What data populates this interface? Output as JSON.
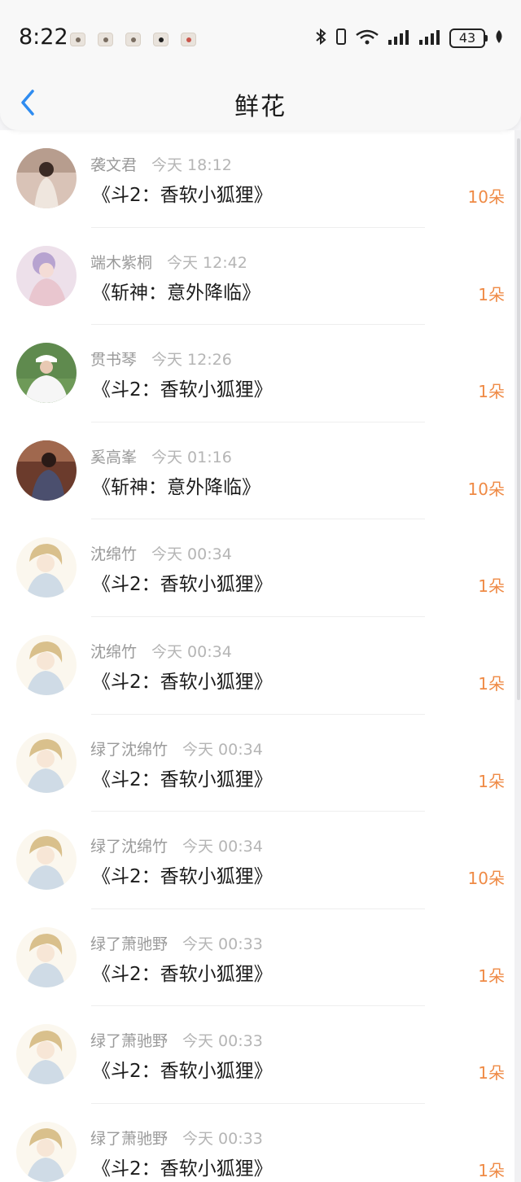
{
  "status_bar": {
    "time": "8:22",
    "battery": "43"
  },
  "header": {
    "title": "鲜花"
  },
  "colors": {
    "accent": "#2f8cf0",
    "count": "#ef8a45"
  },
  "items": [
    {
      "name": "袭文君",
      "time": "今天 18:12",
      "work": "《斗2：香软小狐狸》",
      "count": "10朵"
    },
    {
      "name": "端木紫桐",
      "time": "今天 12:42",
      "work": "《斩神：意外降临》",
      "count": "1朵"
    },
    {
      "name": "贯书琴",
      "time": "今天 12:26",
      "work": "《斗2：香软小狐狸》",
      "count": "1朵"
    },
    {
      "name": "奚高峯",
      "time": "今天 01:16",
      "work": "《斩神：意外降临》",
      "count": "10朵"
    },
    {
      "name": "沈绵竹",
      "time": "今天 00:34",
      "work": "《斗2：香软小狐狸》",
      "count": "1朵"
    },
    {
      "name": "沈绵竹",
      "time": "今天 00:34",
      "work": "《斗2：香软小狐狸》",
      "count": "1朵"
    },
    {
      "name": "绿了沈绵竹",
      "time": "今天 00:34",
      "work": "《斗2：香软小狐狸》",
      "count": "1朵"
    },
    {
      "name": "绿了沈绵竹",
      "time": "今天 00:34",
      "work": "《斗2：香软小狐狸》",
      "count": "10朵"
    },
    {
      "name": "绿了萧驰野",
      "time": "今天 00:33",
      "work": "《斗2：香软小狐狸》",
      "count": "1朵"
    },
    {
      "name": "绿了萧驰野",
      "time": "今天 00:33",
      "work": "《斗2：香软小狐狸》",
      "count": "1朵"
    },
    {
      "name": "绿了萧驰野",
      "time": "今天 00:33",
      "work": "《斗2：香软小狐狸》",
      "count": "1朵"
    }
  ]
}
